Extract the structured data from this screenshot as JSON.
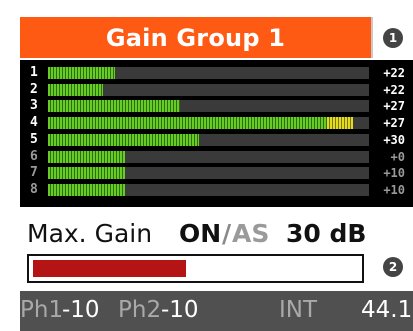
{
  "header": {
    "title": "Gain Group 1",
    "title_bg": "#ff5a14",
    "badge_1": "1"
  },
  "channels": [
    {
      "num": "1",
      "value": "+22",
      "level": 0.21,
      "active": true
    },
    {
      "num": "2",
      "value": "+22",
      "level": 0.17,
      "active": true
    },
    {
      "num": "3",
      "value": "+27",
      "level": 0.41,
      "active": true
    },
    {
      "num": "4",
      "value": "+27",
      "level": 0.87,
      "peak": 0.08,
      "active": true
    },
    {
      "num": "5",
      "value": "+30",
      "level": 0.47,
      "active": true
    },
    {
      "num": "6",
      "value": "+0",
      "level": 0.24,
      "active": false
    },
    {
      "num": "7",
      "value": "+10",
      "level": 0.24,
      "active": false
    },
    {
      "num": "8",
      "value": "+10",
      "level": 0.24,
      "active": false
    }
  ],
  "gain": {
    "label": "Max. Gain",
    "on": "ON",
    "slash": "/",
    "as": "AS",
    "db": "30 dB",
    "level": 0.47,
    "bar_color": "#b41414",
    "badge_2": "2"
  },
  "footer": {
    "ph1_label": "Ph1",
    "ph1_value": "-10",
    "ph2_label": "Ph2",
    "ph2_value": "-10",
    "int_label": "INT",
    "rate": "44.1"
  },
  "icons": [
    "number-1-badge-icon",
    "number-2-badge-icon"
  ]
}
